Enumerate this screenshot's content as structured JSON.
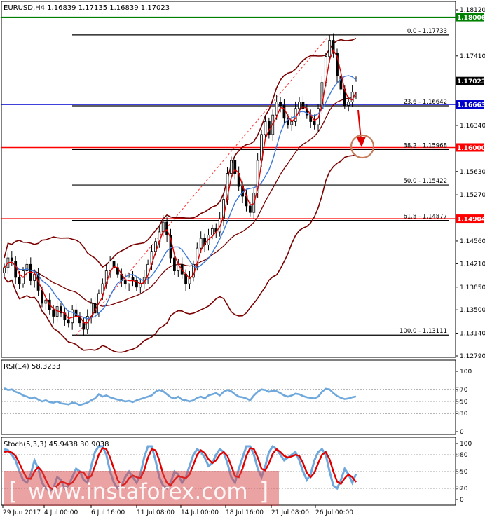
{
  "header": {
    "symbol_line": "EURUSD,H4  1.16839 1.17135 1.16839 1.17023"
  },
  "chart_data": {
    "type": "candlestick",
    "symbol": "EURUSD",
    "timeframe": "H4",
    "ohlc_last": {
      "open": 1.16839,
      "high": 1.17135,
      "low": 1.16839,
      "close": 1.17023
    },
    "price_axis": {
      "min": 1.1279,
      "max": 1.1812,
      "ticks": [
        "1.18120",
        "1.17410",
        "1.16340",
        "1.15630",
        "1.15270",
        "1.14560",
        "1.14210",
        "1.13850",
        "1.13500",
        "1.13140",
        "1.12790"
      ]
    },
    "time_axis_labels": [
      "29 Jun 2017",
      "4 Jul 00:00",
      "6 Jul 16:00",
      "11 Jul 08:00",
      "14 Jul 00:00",
      "18 Jul 16:00",
      "21 Jul 08:00",
      "26 Jul 00:00"
    ],
    "price_tags": [
      {
        "label": "1.18006",
        "price": 1.18006,
        "color": "#008000"
      },
      {
        "label": "1.17023",
        "price": 1.17023,
        "color": "#000000"
      },
      {
        "label": "1.16663",
        "price": 1.16663,
        "color": "#0000cd"
      },
      {
        "label": "1.16000",
        "price": 1.16,
        "color": "#ff0000"
      },
      {
        "label": "1.14904",
        "price": 1.14904,
        "color": "#ff0000"
      }
    ],
    "horizontal_lines": [
      {
        "price": 1.18006,
        "color": "#008000"
      },
      {
        "price": 1.16663,
        "color": "#0000cd"
      },
      {
        "price": 1.16,
        "color": "#ff0000"
      },
      {
        "price": 1.14904,
        "color": "#ff0000"
      }
    ],
    "fibonacci_levels": [
      {
        "label": "0.0 - 1.17733",
        "price": 1.17733
      },
      {
        "label": "23.6 - 1.16642",
        "price": 1.16642
      },
      {
        "label": "38.2 - 1.15968",
        "price": 1.15968
      },
      {
        "label": "50.0 - 1.15422",
        "price": 1.15422
      },
      {
        "label": "61.8 - 1.14877",
        "price": 1.14877
      },
      {
        "label": "100.0 - 1.13111",
        "price": 1.13111
      }
    ],
    "candles_close": [
      1.1415,
      1.143,
      1.1425,
      1.14,
      1.139,
      1.141,
      1.142,
      1.1395,
      1.1405,
      1.138,
      1.136,
      1.1365,
      1.135,
      1.134,
      1.1355,
      1.1345,
      1.1335,
      1.133,
      1.135,
      1.134,
      1.133,
      1.132,
      1.134,
      1.136,
      1.1345,
      1.1375,
      1.139,
      1.141,
      1.1425,
      1.1415,
      1.1405,
      1.1395,
      1.139,
      1.14,
      1.1395,
      1.1385,
      1.139,
      1.14,
      1.142,
      1.144,
      1.1455,
      1.147,
      1.1485,
      1.1465,
      1.143,
      1.141,
      1.142,
      1.1405,
      1.139,
      1.14,
      1.142,
      1.1445,
      1.146,
      1.145,
      1.1465,
      1.1475,
      1.147,
      1.149,
      1.152,
      1.156,
      1.158,
      1.156,
      1.154,
      1.1525,
      1.151,
      1.15,
      1.153,
      1.158,
      1.162,
      1.164,
      1.162,
      1.165,
      1.167,
      1.1665,
      1.1645,
      1.1635,
      1.164,
      1.166,
      1.167,
      1.166,
      1.165,
      1.164,
      1.1635,
      1.166,
      1.17,
      1.174,
      1.1765,
      1.1745,
      1.171,
      1.169,
      1.1665,
      1.167,
      1.1685,
      1.1702
    ],
    "rsi": {
      "label": "RSI(14) 58.3233",
      "value": 58.3233,
      "levels": [
        70,
        50,
        30
      ],
      "axis_ticks": [
        "100",
        "70",
        "50",
        "30",
        "0"
      ],
      "values": [
        72,
        69,
        70,
        66,
        64,
        60,
        58,
        55,
        57,
        53,
        50,
        52,
        49,
        48,
        50,
        47,
        46,
        45,
        48,
        47,
        44,
        46,
        48,
        52,
        55,
        62,
        58,
        60,
        57,
        55,
        53,
        52,
        50,
        51,
        49,
        52,
        54,
        56,
        58,
        60,
        66,
        69,
        67,
        62,
        57,
        55,
        58,
        53,
        52,
        50,
        52,
        56,
        58,
        55,
        60,
        62,
        64,
        60,
        66,
        69,
        67,
        62,
        58,
        57,
        55,
        52,
        60,
        66,
        70,
        69,
        66,
        68,
        67,
        64,
        60,
        58,
        60,
        63,
        62,
        59,
        57,
        56,
        55,
        58,
        66,
        71,
        70,
        64,
        59,
        56,
        54,
        55,
        57,
        58.3
      ]
    },
    "stochastic": {
      "label": "Stoch(5,3,3) 45.9438 30.9038",
      "main": 45.9438,
      "signal": 30.9038,
      "levels": [
        80,
        50,
        20
      ],
      "axis_ticks": [
        "100",
        "80",
        "50",
        "20",
        "0"
      ],
      "main_values": [
        90,
        88,
        80,
        70,
        50,
        35,
        30,
        45,
        70,
        55,
        30,
        20,
        15,
        20,
        40,
        35,
        20,
        25,
        40,
        55,
        50,
        35,
        30,
        60,
        85,
        95,
        95,
        80,
        50,
        30,
        20,
        25,
        40,
        50,
        40,
        30,
        45,
        75,
        95,
        95,
        70,
        40,
        25,
        20,
        30,
        50,
        45,
        30,
        40,
        60,
        80,
        90,
        85,
        75,
        60,
        65,
        80,
        90,
        85,
        65,
        40,
        30,
        55,
        75,
        95,
        95,
        80,
        55,
        40,
        60,
        85,
        95,
        90,
        80,
        70,
        75,
        80,
        85,
        70,
        50,
        35,
        45,
        70,
        85,
        90,
        80,
        50,
        25,
        20,
        35,
        55,
        45,
        30,
        46
      ],
      "signal_values": [
        85,
        86,
        84,
        78,
        65,
        50,
        38,
        37,
        50,
        58,
        50,
        35,
        22,
        18,
        25,
        32,
        30,
        27,
        30,
        40,
        50,
        48,
        38,
        42,
        60,
        80,
        92,
        90,
        75,
        55,
        35,
        25,
        28,
        38,
        43,
        40,
        38,
        52,
        75,
        90,
        88,
        70,
        45,
        30,
        25,
        35,
        42,
        40,
        38,
        45,
        62,
        80,
        88,
        83,
        72,
        65,
        70,
        80,
        85,
        78,
        60,
        42,
        40,
        55,
        78,
        92,
        90,
        75,
        55,
        52,
        65,
        82,
        90,
        85,
        78,
        75,
        77,
        80,
        78,
        65,
        48,
        40,
        48,
        65,
        80,
        85,
        72,
        50,
        32,
        28,
        38,
        45,
        40,
        31
      ]
    }
  },
  "watermark": {
    "text": "www.instaforex.com",
    "bracket_open": "[",
    "bracket_close": "]"
  }
}
